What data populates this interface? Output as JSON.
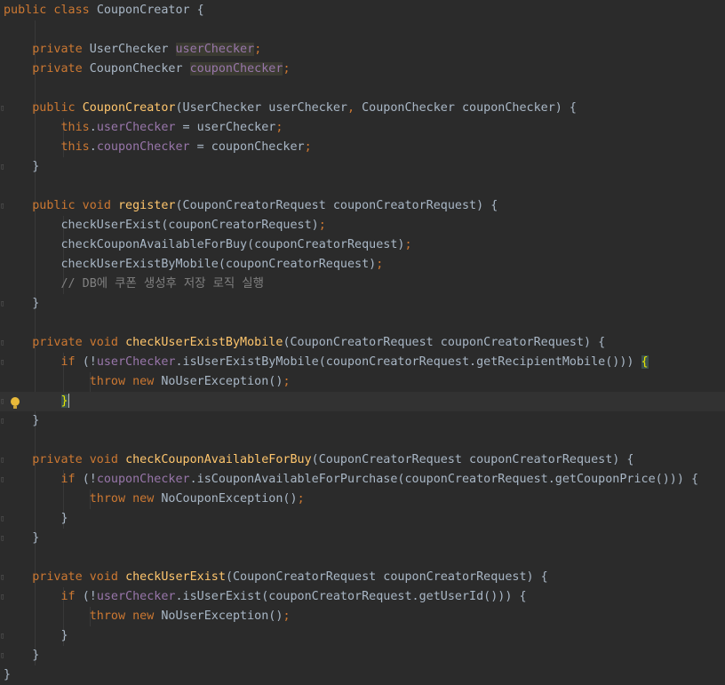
{
  "editor": {
    "lines": [
      {
        "i": 0,
        "segments": [
          {
            "c": "kw",
            "t": "public class "
          },
          {
            "c": "",
            "t": "CouponCreator {"
          }
        ]
      },
      {
        "i": 1,
        "segments": []
      },
      {
        "i": 2,
        "segments": [
          {
            "c": "kw",
            "t": "    private "
          },
          {
            "c": "",
            "t": "UserChecker "
          },
          {
            "c": "fld hl",
            "t": "userChecker"
          },
          {
            "c": "kw",
            "t": ";"
          }
        ]
      },
      {
        "i": 3,
        "segments": [
          {
            "c": "kw",
            "t": "    private "
          },
          {
            "c": "",
            "t": "CouponChecker "
          },
          {
            "c": "fld hl",
            "t": "couponChecker"
          },
          {
            "c": "kw",
            "t": ";"
          }
        ]
      },
      {
        "i": 4,
        "segments": []
      },
      {
        "i": 5,
        "segments": [
          {
            "c": "kw",
            "t": "    public "
          },
          {
            "c": "fn",
            "t": "CouponCreator"
          },
          {
            "c": "",
            "t": "(UserChecker userChecker"
          },
          {
            "c": "kw",
            "t": ", "
          },
          {
            "c": "",
            "t": "CouponChecker couponChecker) {"
          }
        ]
      },
      {
        "i": 6,
        "segments": [
          {
            "c": "kw",
            "t": "        this"
          },
          {
            "c": "",
            "t": "."
          },
          {
            "c": "fld",
            "t": "userChecker"
          },
          {
            "c": "",
            "t": " = userChecker"
          },
          {
            "c": "kw",
            "t": ";"
          }
        ]
      },
      {
        "i": 7,
        "segments": [
          {
            "c": "kw",
            "t": "        this"
          },
          {
            "c": "",
            "t": "."
          },
          {
            "c": "fld",
            "t": "couponChecker"
          },
          {
            "c": "",
            "t": " = couponChecker"
          },
          {
            "c": "kw",
            "t": ";"
          }
        ]
      },
      {
        "i": 8,
        "segments": [
          {
            "c": "",
            "t": "    }"
          }
        ]
      },
      {
        "i": 9,
        "segments": []
      },
      {
        "i": 10,
        "segments": [
          {
            "c": "kw",
            "t": "    public void "
          },
          {
            "c": "fn",
            "t": "register"
          },
          {
            "c": "",
            "t": "(CouponCreatorRequest couponCreatorRequest) {"
          }
        ]
      },
      {
        "i": 11,
        "segments": [
          {
            "c": "",
            "t": "        checkUserExist(couponCreatorRequest)"
          },
          {
            "c": "kw",
            "t": ";"
          }
        ]
      },
      {
        "i": 12,
        "segments": [
          {
            "c": "",
            "t": "        checkCouponAvailableForBuy(couponCreatorRequest)"
          },
          {
            "c": "kw",
            "t": ";"
          }
        ]
      },
      {
        "i": 13,
        "segments": [
          {
            "c": "",
            "t": "        checkUserExistByMobile(couponCreatorRequest)"
          },
          {
            "c": "kw",
            "t": ";"
          }
        ]
      },
      {
        "i": 14,
        "segments": [
          {
            "c": "cm",
            "t": "        // DB에 쿠폰 생성후 저장 로직 실행"
          }
        ]
      },
      {
        "i": 15,
        "segments": [
          {
            "c": "",
            "t": "    }"
          }
        ]
      },
      {
        "i": 16,
        "segments": []
      },
      {
        "i": 17,
        "segments": [
          {
            "c": "kw",
            "t": "    private void "
          },
          {
            "c": "fn",
            "t": "checkUserExistByMobile"
          },
          {
            "c": "",
            "t": "(CouponCreatorRequest couponCreatorRequest) {"
          }
        ]
      },
      {
        "i": 18,
        "segments": [
          {
            "c": "kw",
            "t": "        if "
          },
          {
            "c": "",
            "t": "(!"
          },
          {
            "c": "fld",
            "t": "userChecker"
          },
          {
            "c": "",
            "t": ".isUserExistByMobile(couponCreatorRequest.getRecipientMobile())) "
          },
          {
            "c": "brace-hl",
            "t": "{"
          }
        ]
      },
      {
        "i": 19,
        "segments": [
          {
            "c": "kw",
            "t": "            throw new "
          },
          {
            "c": "",
            "t": "NoUserException()"
          },
          {
            "c": "kw",
            "t": ";"
          }
        ]
      },
      {
        "i": 20,
        "segments": [
          {
            "c": "",
            "t": "        "
          },
          {
            "c": "brace-hl",
            "t": "}"
          }
        ]
      },
      {
        "i": 21,
        "segments": [
          {
            "c": "",
            "t": "    }"
          }
        ]
      },
      {
        "i": 22,
        "segments": []
      },
      {
        "i": 23,
        "segments": [
          {
            "c": "kw",
            "t": "    private void "
          },
          {
            "c": "fn",
            "t": "checkCouponAvailableForBuy"
          },
          {
            "c": "",
            "t": "(CouponCreatorRequest couponCreatorRequest) {"
          }
        ]
      },
      {
        "i": 24,
        "segments": [
          {
            "c": "kw",
            "t": "        if "
          },
          {
            "c": "",
            "t": "(!"
          },
          {
            "c": "fld",
            "t": "couponChecker"
          },
          {
            "c": "",
            "t": ".isCouponAvailableForPurchase(couponCreatorRequest.getCouponPrice())) {"
          }
        ]
      },
      {
        "i": 25,
        "segments": [
          {
            "c": "kw",
            "t": "            throw new "
          },
          {
            "c": "",
            "t": "NoCouponException()"
          },
          {
            "c": "kw",
            "t": ";"
          }
        ]
      },
      {
        "i": 26,
        "segments": [
          {
            "c": "",
            "t": "        }"
          }
        ]
      },
      {
        "i": 27,
        "segments": [
          {
            "c": "",
            "t": "    }"
          }
        ]
      },
      {
        "i": 28,
        "segments": []
      },
      {
        "i": 29,
        "segments": [
          {
            "c": "kw",
            "t": "    private void "
          },
          {
            "c": "fn",
            "t": "checkUserExist"
          },
          {
            "c": "",
            "t": "(CouponCreatorRequest couponCreatorRequest) {"
          }
        ]
      },
      {
        "i": 30,
        "segments": [
          {
            "c": "kw",
            "t": "        if "
          },
          {
            "c": "",
            "t": "(!"
          },
          {
            "c": "fld",
            "t": "userChecker"
          },
          {
            "c": "",
            "t": ".isUserExist(couponCreatorRequest.getUserId())) {"
          }
        ]
      },
      {
        "i": 31,
        "segments": [
          {
            "c": "kw",
            "t": "            throw new "
          },
          {
            "c": "",
            "t": "NoUserException()"
          },
          {
            "c": "kw",
            "t": ";"
          }
        ]
      },
      {
        "i": 32,
        "segments": [
          {
            "c": "",
            "t": "        }"
          }
        ]
      },
      {
        "i": 33,
        "segments": [
          {
            "c": "",
            "t": "    }"
          }
        ]
      },
      {
        "i": 34,
        "segments": [
          {
            "c": "",
            "t": "}"
          }
        ]
      }
    ],
    "current_line": 20,
    "fold_lines": [
      5,
      8,
      10,
      15,
      17,
      18,
      20,
      21,
      23,
      24,
      26,
      27,
      29,
      30,
      32,
      33
    ],
    "bulb_line": 20,
    "bulb_icon": "lightbulb-icon"
  }
}
